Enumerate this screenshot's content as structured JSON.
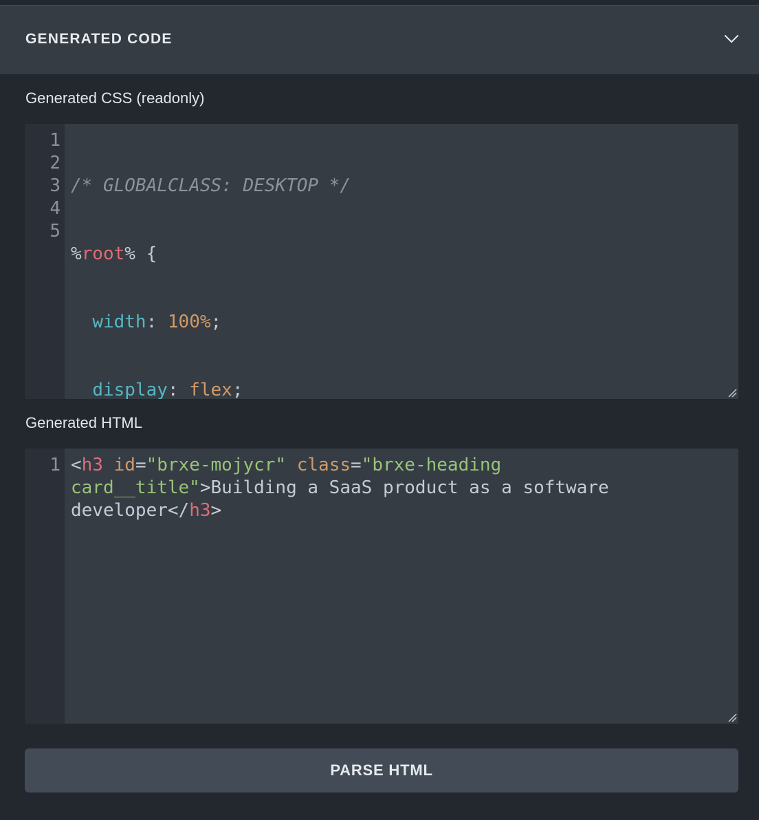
{
  "panel": {
    "title": "GENERATED CODE",
    "toggle_icon": "chevron-down-icon"
  },
  "css_editor": {
    "label": "Generated CSS (readonly)",
    "line_numbers": [
      "1",
      "2",
      "3",
      "4",
      "5"
    ],
    "lines": {
      "l1_comment": "/* GLOBALCLASS: DESKTOP */",
      "l2_pct1": "%",
      "l2_root": "root",
      "l2_pct2": "%",
      "l2_brace": " {",
      "l3_indent": "  ",
      "l3_prop": "width",
      "l3_colon": ": ",
      "l3_val": "100%",
      "l3_semi": ";",
      "l4_indent": "  ",
      "l4_prop": "display",
      "l4_colon": ": ",
      "l4_val": "flex",
      "l4_semi": ";",
      "l5_brace": "}"
    }
  },
  "html_editor": {
    "label": "Generated HTML",
    "line_numbers": [
      "1"
    ],
    "tokens": {
      "lt1": "<",
      "tag_open": "h3",
      "sp1": " ",
      "attr_id": "id",
      "eq1": "=",
      "val_id": "\"brxe-mojycr\"",
      "sp2": " ",
      "attr_class": "class",
      "eq2": "=",
      "val_class": "\"brxe-heading card__title\"",
      "gt1": ">",
      "text": "Building a SaaS product as a software developer",
      "lt2": "</",
      "tag_close": "h3",
      "gt2": ">"
    }
  },
  "parse_button": {
    "label": "PARSE HTML"
  }
}
